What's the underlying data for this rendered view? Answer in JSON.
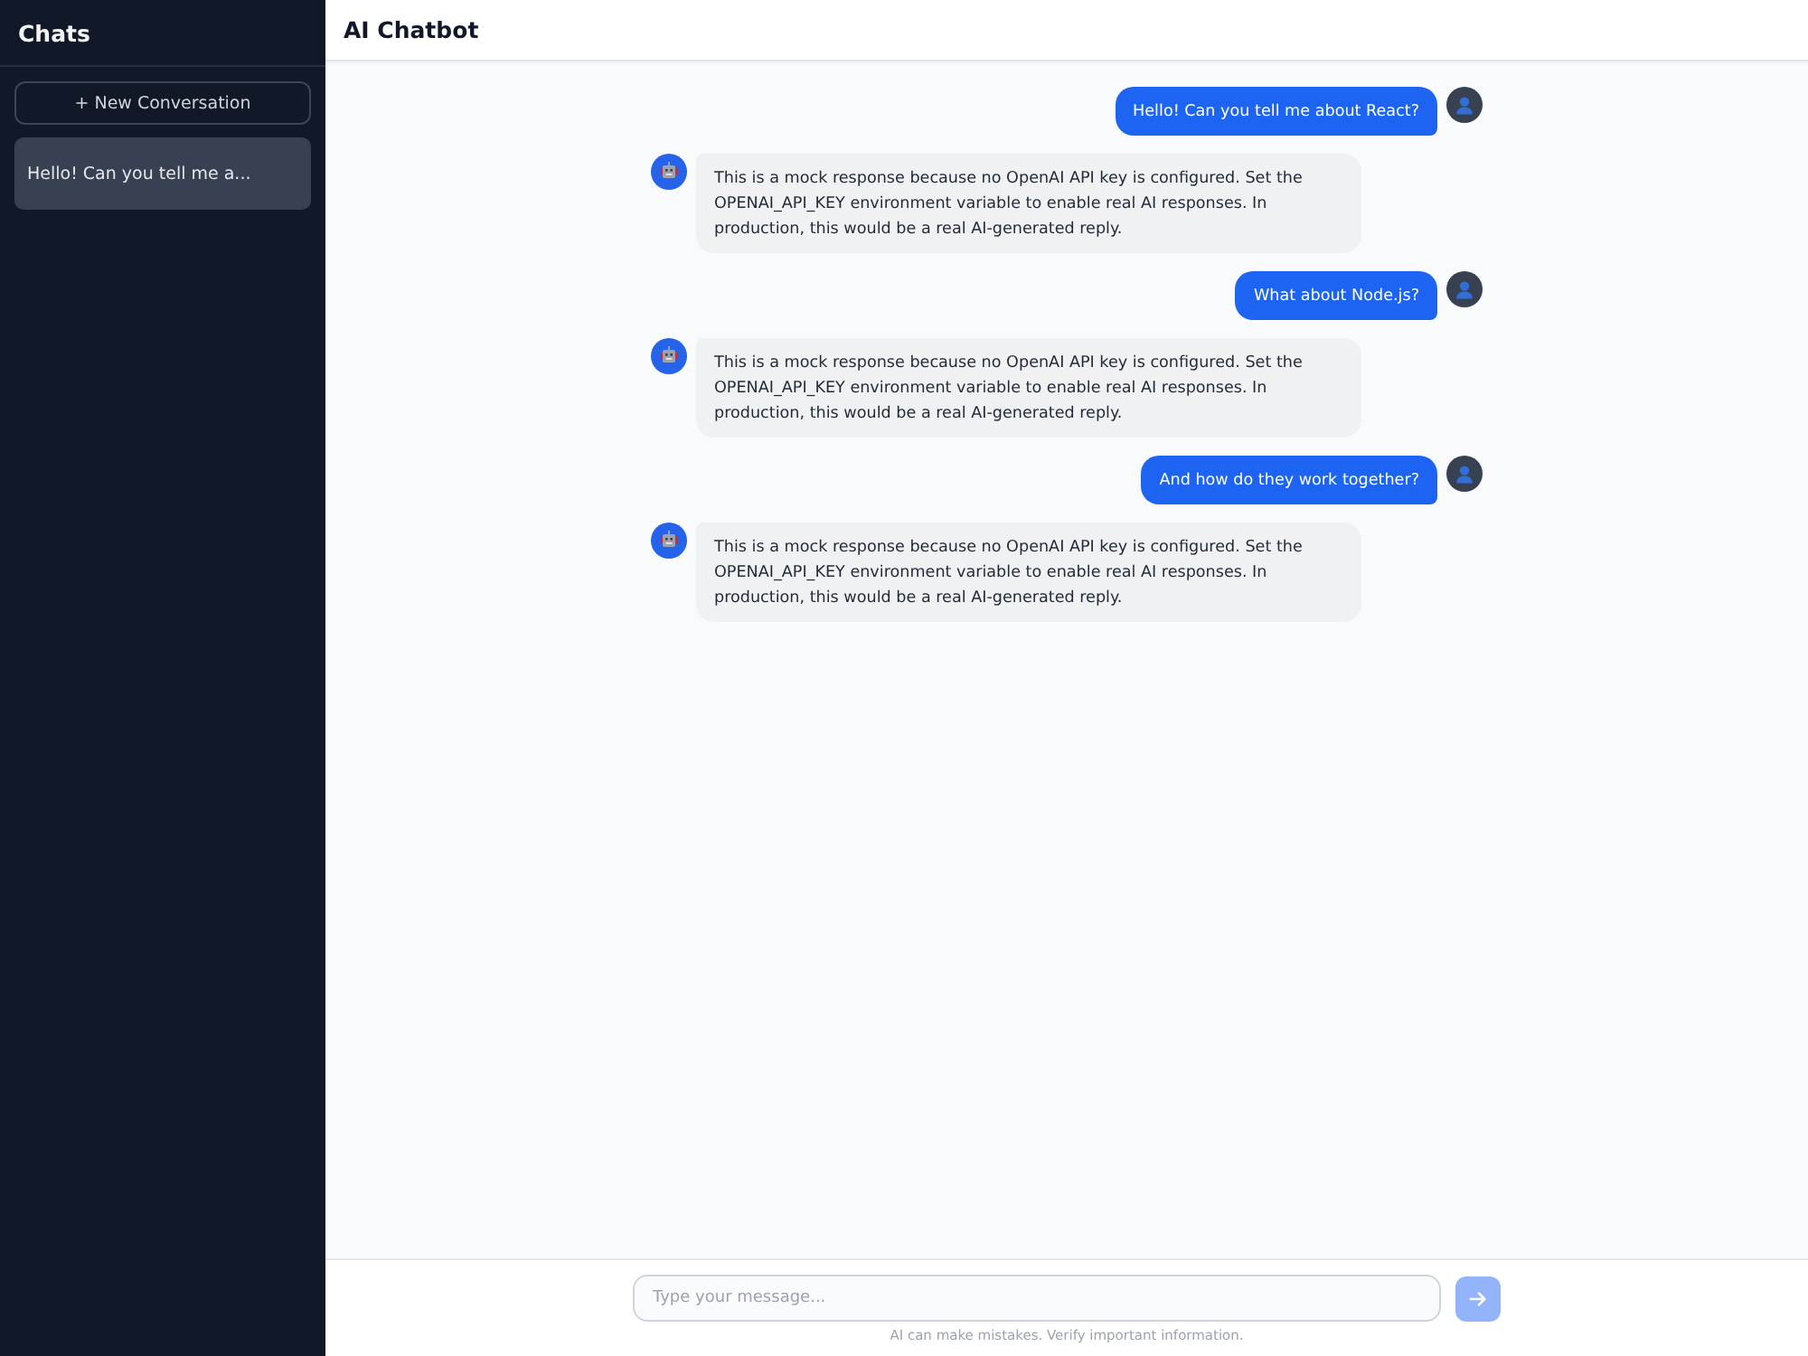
{
  "sidebar": {
    "title": "Chats",
    "new_button": "+ New Conversation",
    "conversations": [
      {
        "title": "Hello! Can you tell me a...",
        "selected": true
      }
    ]
  },
  "header": {
    "title": "AI Chatbot"
  },
  "messages": [
    {
      "kind": "user",
      "text": "Hello! Can you tell me about React?"
    },
    {
      "kind": "assistant",
      "text": "This is a mock response because no OpenAI API key is configured. Set the OPENAI_API_KEY environment variable to enable real AI responses. In production, this would be a real AI-generated reply."
    },
    {
      "kind": "user",
      "text": "What about Node.js?"
    },
    {
      "kind": "assistant",
      "text": "This is a mock response because no OpenAI API key is configured. Set the OPENAI_API_KEY environment variable to enable real AI responses. In production, this would be a real AI-generated reply."
    },
    {
      "kind": "user",
      "text": "And how do they work together?"
    },
    {
      "kind": "assistant",
      "text": "This is a mock response because no OpenAI API key is configured. Set the OPENAI_API_KEY environment variable to enable real AI responses. In production, this would be a real AI-generated reply."
    }
  ],
  "composer": {
    "placeholder": "Type your message...",
    "send_disabled": true,
    "disclaimer": "AI can make mistakes. Verify important information."
  }
}
